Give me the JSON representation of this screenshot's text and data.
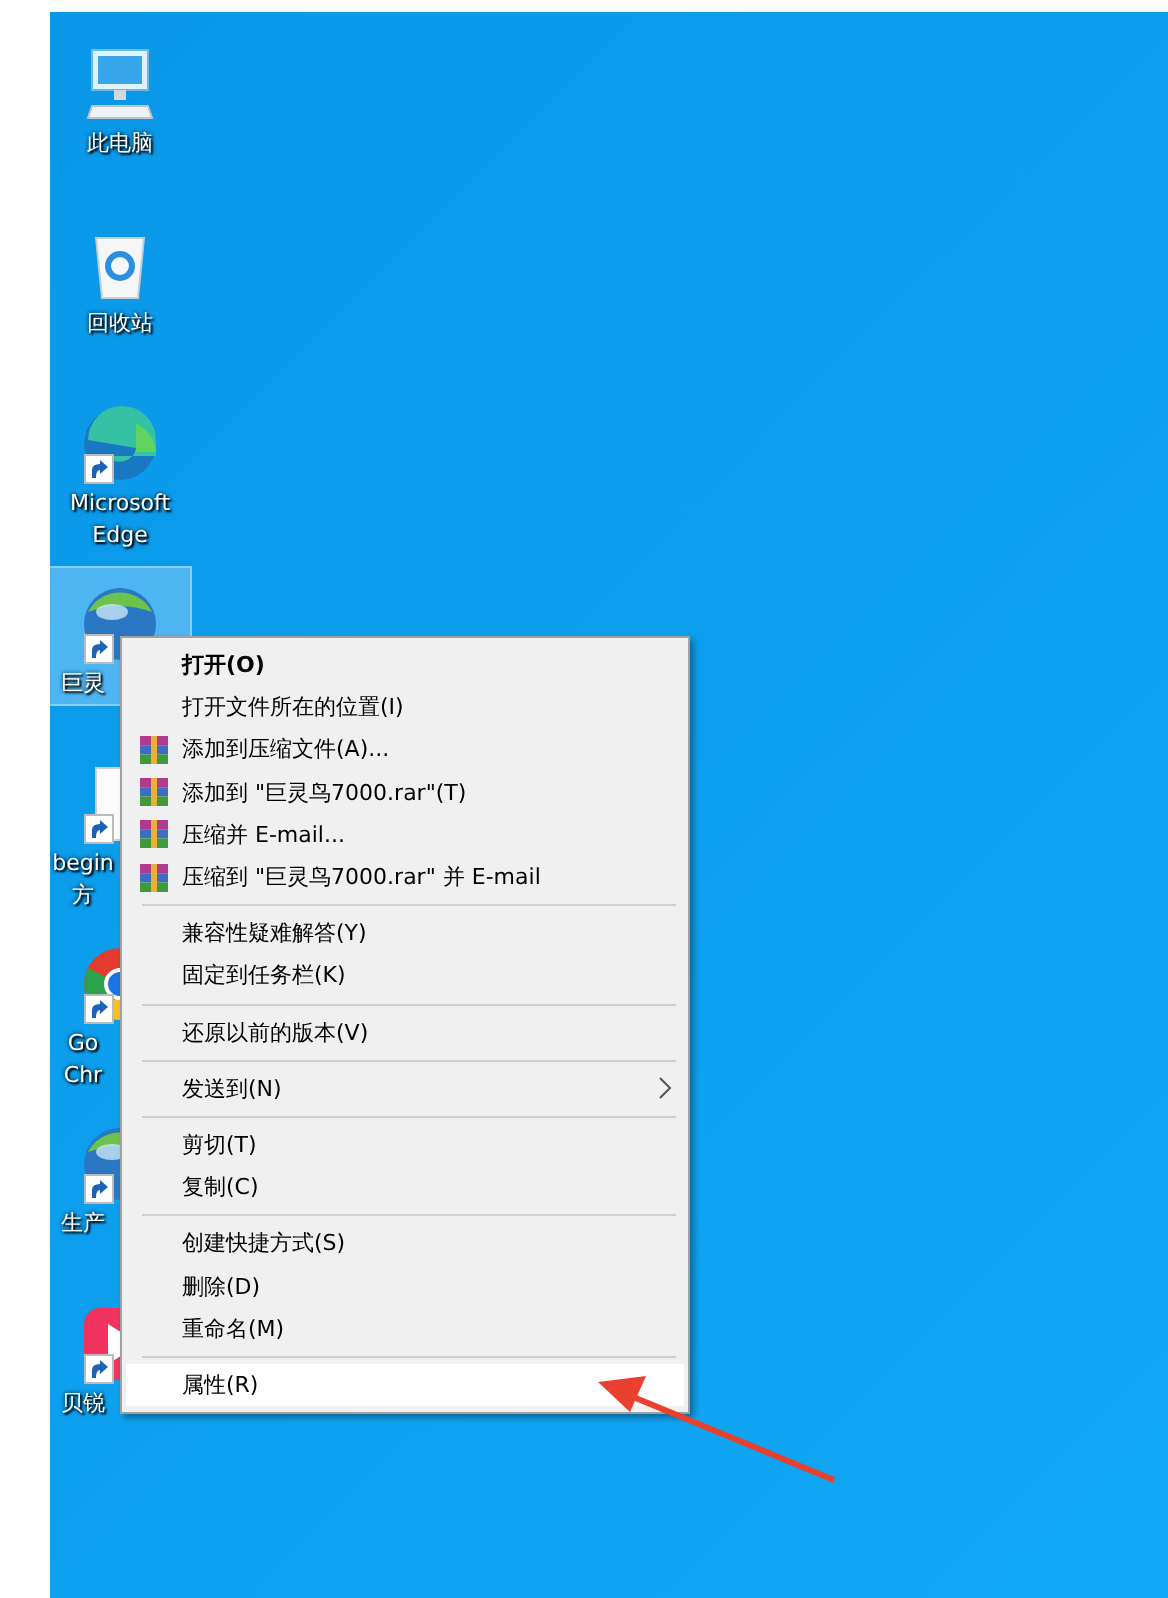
{
  "desktop_icons": [
    {
      "kind": "computer",
      "shortcut": false,
      "selected": false,
      "label": [
        "此电脑"
      ]
    },
    {
      "kind": "recycle",
      "shortcut": false,
      "selected": false,
      "label": [
        "回收站"
      ]
    },
    {
      "kind": "edge",
      "shortcut": true,
      "selected": false,
      "label": [
        "Microsoft",
        "Edge"
      ]
    },
    {
      "kind": "globe",
      "shortcut": true,
      "selected": true,
      "label": [
        "巨灵"
      ]
    },
    {
      "kind": "document",
      "shortcut": true,
      "selected": false,
      "label": [
        "begin",
        "方"
      ]
    },
    {
      "kind": "chrome",
      "shortcut": true,
      "selected": false,
      "label": [
        "Go",
        "Chr"
      ]
    },
    {
      "kind": "globe",
      "shortcut": true,
      "selected": false,
      "label": [
        "生产"
      ]
    },
    {
      "kind": "player",
      "shortcut": true,
      "selected": false,
      "label": [
        "贝锐"
      ]
    }
  ],
  "context_menu": [
    {
      "kind": "item",
      "label": "打开(O)",
      "default": true,
      "submenu": false,
      "selected": false
    },
    {
      "kind": "item",
      "label": "打开文件所在的位置(I)",
      "default": false,
      "submenu": false,
      "selected": false
    },
    {
      "kind": "archive",
      "label": "添加到压缩文件(A)...",
      "default": false,
      "submenu": false,
      "selected": false
    },
    {
      "kind": "archive",
      "label": "添加到 \"巨灵鸟7000.rar\"(T)",
      "default": false,
      "submenu": false,
      "selected": false
    },
    {
      "kind": "archive",
      "label": "压缩并 E-mail...",
      "default": false,
      "submenu": false,
      "selected": false
    },
    {
      "kind": "archive",
      "label": "压缩到 \"巨灵鸟7000.rar\" 并 E-mail",
      "default": false,
      "submenu": false,
      "selected": false
    },
    {
      "kind": "separator"
    },
    {
      "kind": "item",
      "label": "兼容性疑难解答(Y)",
      "default": false,
      "submenu": false,
      "selected": false
    },
    {
      "kind": "item",
      "label": "固定到任务栏(K)",
      "default": false,
      "submenu": false,
      "selected": false
    },
    {
      "kind": "separator"
    },
    {
      "kind": "item",
      "label": "还原以前的版本(V)",
      "default": false,
      "submenu": false,
      "selected": false
    },
    {
      "kind": "separator"
    },
    {
      "kind": "item",
      "label": "发送到(N)",
      "default": false,
      "submenu": true,
      "selected": false
    },
    {
      "kind": "separator"
    },
    {
      "kind": "item",
      "label": "剪切(T)",
      "default": false,
      "submenu": false,
      "selected": false
    },
    {
      "kind": "item",
      "label": "复制(C)",
      "default": false,
      "submenu": false,
      "selected": false
    },
    {
      "kind": "separator"
    },
    {
      "kind": "item",
      "label": "创建快捷方式(S)",
      "default": false,
      "submenu": false,
      "selected": false
    },
    {
      "kind": "item",
      "label": "删除(D)",
      "default": false,
      "submenu": false,
      "selected": false
    },
    {
      "kind": "item",
      "label": "重命名(M)",
      "default": false,
      "submenu": false,
      "selected": false
    },
    {
      "kind": "separator"
    },
    {
      "kind": "item",
      "label": "属性(R)",
      "default": false,
      "submenu": false,
      "selected": true
    }
  ],
  "annotation": {
    "kind": "arrow"
  }
}
